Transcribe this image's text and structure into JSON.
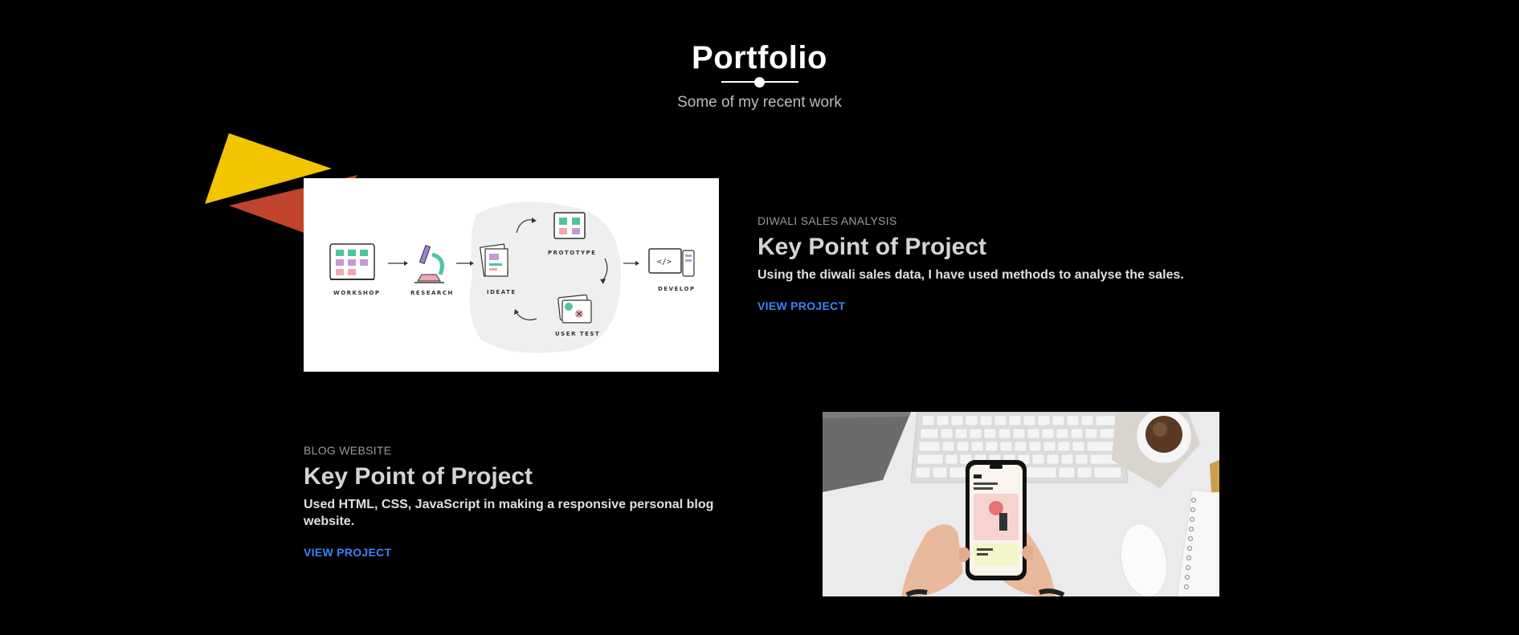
{
  "header": {
    "title": "Portfolio",
    "subtitle": "Some of my recent work"
  },
  "colors": {
    "background": "#000000",
    "link": "#3b82f6",
    "triangle_yellow": "#f2c500",
    "triangle_red": "#c0442c"
  },
  "projects": [
    {
      "category": "DIWALI SALES ANALYSIS",
      "heading": "Key Point of Project",
      "description": "Using the diwali sales data, I have used methods to analyse the sales.",
      "link_label": "VIEW PROJECT",
      "image": {
        "icon": "design-process-diagram",
        "labels": [
          "WORKSHOP",
          "RESEARCH",
          "IDEATE",
          "PROTOTYPE",
          "USER TEST",
          "DEVELOP"
        ]
      }
    },
    {
      "category": "BLOG WEBSITE",
      "heading": "Key Point of Project",
      "description": "Used HTML, CSS, JavaScript in making a responsive personal blog website.",
      "link_label": "VIEW PROJECT",
      "image": {
        "icon": "hands-holding-phone-on-desk"
      }
    }
  ]
}
